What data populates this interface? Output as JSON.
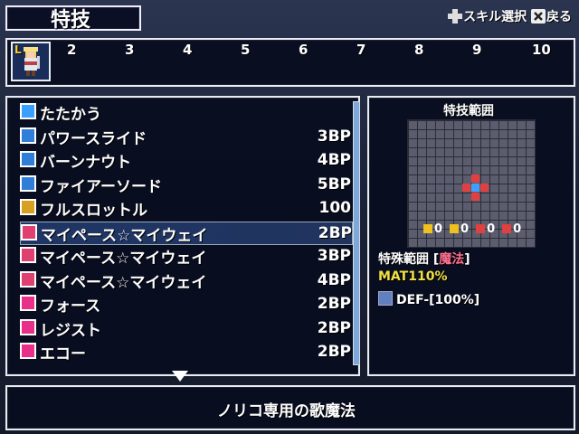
{
  "header": {
    "title": "特技",
    "hint_select": "スキル選択",
    "hint_back": "戻る"
  },
  "party": {
    "slots": [
      "2",
      "3",
      "4",
      "5",
      "6",
      "7",
      "8",
      "9",
      "10"
    ],
    "portrait_badge": "L"
  },
  "skills": [
    {
      "name": "たたかう",
      "cost": "",
      "icon": "sword-icon",
      "icon_color": "#3aa0ff"
    },
    {
      "name": "パワースライド",
      "cost": "3BP",
      "icon": "skill-icon",
      "icon_color": "#2f7fd8"
    },
    {
      "name": "バーンナウト",
      "cost": "4BP",
      "icon": "skill-icon",
      "icon_color": "#2f7fd8"
    },
    {
      "name": "ファイアーソード",
      "cost": "5BP",
      "icon": "skill-icon",
      "icon_color": "#2f7fd8"
    },
    {
      "name": "フルスロットル",
      "cost": "100",
      "icon": "ultimate-icon",
      "icon_color": "#d8a020"
    },
    {
      "name": "マイペース☆マイウェイ",
      "cost": "2BP",
      "icon": "song-icon",
      "icon_color": "#e04070"
    },
    {
      "name": "マイペース☆マイウェイ",
      "cost": "3BP",
      "icon": "song-plus-icon",
      "icon_color": "#e04070"
    },
    {
      "name": "マイペース☆マイウェイ",
      "cost": "4BP",
      "icon": "song-plus2-icon",
      "icon_color": "#e04070"
    },
    {
      "name": "フォース",
      "cost": "2BP",
      "icon": "level-icon",
      "icon_color": "#e8308a"
    },
    {
      "name": "レジスト",
      "cost": "2BP",
      "icon": "level-icon",
      "icon_color": "#e8308a"
    },
    {
      "name": "エコー",
      "cost": "2BP",
      "icon": "level-icon",
      "icon_color": "#e8308a"
    }
  ],
  "selected_index": 5,
  "info": {
    "range_title": "特技範囲",
    "elements": [
      {
        "value": "0",
        "color": "#f0c020"
      },
      {
        "value": "0",
        "color": "#f0c020"
      },
      {
        "value": "0",
        "color": "#e04040"
      },
      {
        "value": "0",
        "color": "#e04040"
      }
    ],
    "special_label": "特殊範囲 [",
    "special_value": "魔法",
    "special_close": "]",
    "mat": "MAT110%",
    "def": "DEF-[100%]"
  },
  "description": "ノリコ専用の歌魔法"
}
